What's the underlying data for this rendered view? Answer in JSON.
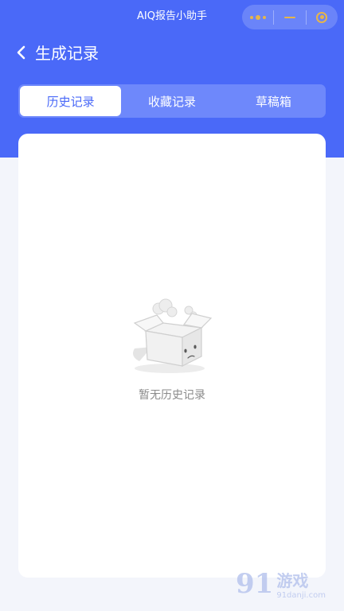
{
  "miniapp": {
    "title": "AIQ报告小助手"
  },
  "header": {
    "title": "生成记录"
  },
  "tabs": [
    {
      "label": "历史记录",
      "active": true
    },
    {
      "label": "收藏记录",
      "active": false
    },
    {
      "label": "草稿箱",
      "active": false
    }
  ],
  "empty_state": {
    "text": "暂无历史记录"
  },
  "watermark": {
    "number": "91",
    "name": "游戏",
    "site": "91danji.com"
  },
  "colors": {
    "primary": "#4a69f8",
    "background": "#f3f5fb",
    "capsule_icon": "#e6b54b"
  },
  "icons": {
    "back": "chevron-left-icon",
    "more": "more-dots-icon",
    "minimize": "minimize-icon",
    "close": "close-target-icon",
    "empty": "empty-box-icon"
  }
}
